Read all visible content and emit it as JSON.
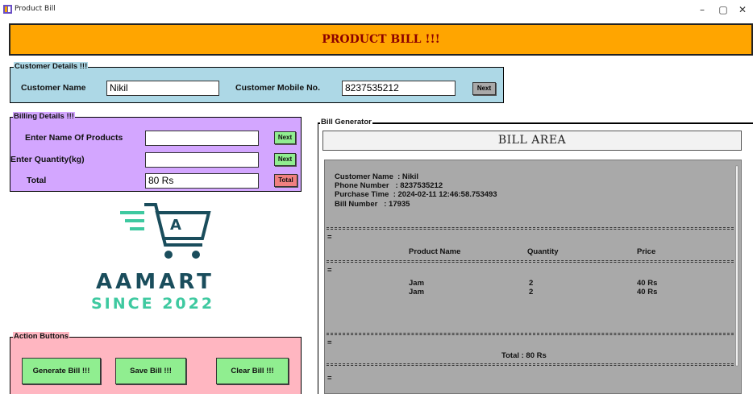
{
  "window": {
    "title": "Product Bill",
    "minimize": "–",
    "maximize": "▢",
    "close": "✕"
  },
  "header": {
    "title": "PRODUCT BILL !!!"
  },
  "customer": {
    "legend": "Customer Details !!!",
    "name_label": "Customer Name",
    "name_value": "Nikil",
    "mobile_label": "Customer Mobile No.",
    "mobile_value": "8237535212",
    "next_label": "Next"
  },
  "billing": {
    "legend": "Billing Details !!!",
    "product_label": "Enter Name Of Products",
    "product_value": "",
    "quantity_label": "Enter Quantity(kg)",
    "quantity_value": "",
    "total_label": "Total",
    "total_value": "80 Rs",
    "next_label_1": "Next",
    "next_label_2": "Next",
    "total_button": "Total"
  },
  "logo": {
    "letter": "A",
    "brand": "AAMART",
    "since": "SINCE 2022"
  },
  "actions": {
    "legend": "Action Buttons",
    "generate": "Generate Bill !!!",
    "save": "Save Bill !!!",
    "clear": "Clear Bill !!!"
  },
  "bill": {
    "legend": "Bill Generator",
    "area_title": "BILL AREA",
    "customer_line": "Customer Name  : Nikil",
    "phone_line": "Phone Number   : 8237535212",
    "time_line": "Purchase Time  : 2024-02-11 12:46:58.753493",
    "number_line": "Bill Number   : 17935",
    "eq_mark": "=",
    "col_product": "Product Name",
    "col_quantity": "Quantity",
    "col_price": "Price",
    "items": [
      {
        "name": "Jam",
        "qty": "2",
        "price": "40 Rs"
      },
      {
        "name": "Jam",
        "qty": "2",
        "price": "40 Rs"
      }
    ],
    "total_line": "Total : 80 Rs"
  },
  "colors": {
    "header_bg": "#ffa500",
    "header_text": "#8b0000",
    "customer_frame": "#add8e6",
    "billing_frame": "#d3a6ff",
    "action_frame": "#ffb6c1",
    "button_green": "#90ee90",
    "button_red": "#f08080",
    "bill_bg": "#a9a9a9",
    "logo_teal": "#1a4d5c",
    "logo_green": "#3ec9a0"
  }
}
